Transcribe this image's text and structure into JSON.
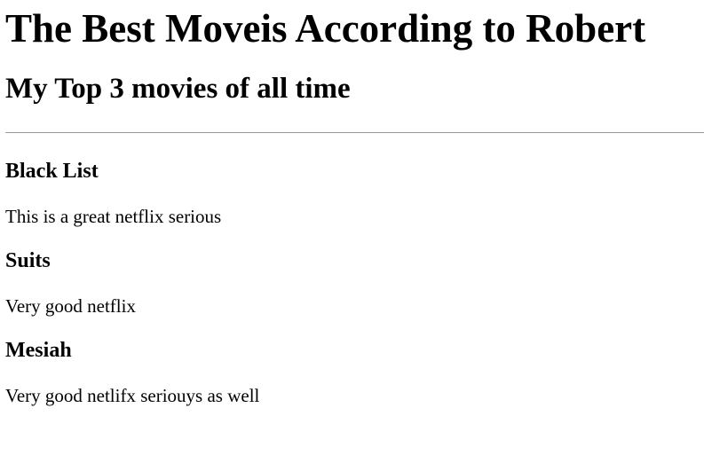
{
  "page": {
    "title": "The Best Moveis According to Robert",
    "subtitle": "My Top 3 movies of all time"
  },
  "movies": [
    {
      "name": "Black List",
      "description": "This is a great netflix serious"
    },
    {
      "name": "Suits",
      "description": "Very good netflix"
    },
    {
      "name": "Mesiah",
      "description": "Very good netlifx seriouys as well"
    }
  ]
}
